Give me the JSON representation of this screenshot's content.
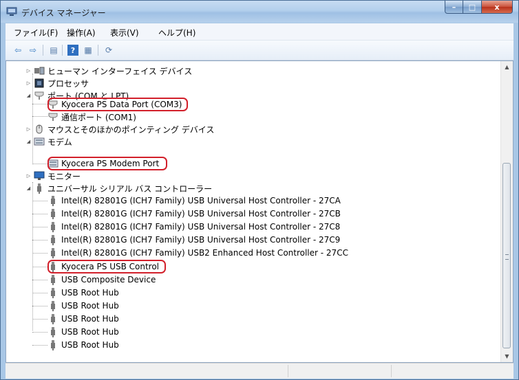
{
  "window": {
    "title": "デバイス マネージャー"
  },
  "caption": {
    "minimize": "–",
    "maximize": "□",
    "close": "x"
  },
  "menu": [
    "ファイル(F)",
    "操作(A)",
    "表示(V)",
    "ヘルプ(H)"
  ],
  "toolbar": {
    "buttons": [
      "back-arrow-icon",
      "forward-arrow-icon",
      "console-tree-icon",
      "help-icon",
      "properties-icon",
      "scan-hardware-icon"
    ],
    "glyphs": {
      "back": "⇦",
      "forward": "⇨",
      "tree": "▤",
      "help": "?",
      "props": "▦",
      "scan": "⟳"
    }
  },
  "tree": {
    "hid": "ヒューマン インターフェイス デバイス",
    "processor": "プロセッサ",
    "ports": "ポート (COM と LPT)",
    "ports_children": [
      "Kyocera PS Data Port (COM3)",
      "通信ポート (COM1)"
    ],
    "mouse": "マウスとそのほかのポインティング デバイス",
    "modem": "モデム",
    "modem_children": [
      "Kyocera PS Modem Port"
    ],
    "monitor": "モニター",
    "usb": "ユニバーサル シリアル バス コントローラー",
    "usb_children": [
      "Intel(R) 82801G (ICH7 Family) USB Universal Host Controller - 27CA",
      "Intel(R) 82801G (ICH7 Family) USB Universal Host Controller - 27CB",
      "Intel(R) 82801G (ICH7 Family) USB Universal Host Controller - 27C8",
      "Intel(R) 82801G (ICH7 Family) USB Universal Host Controller - 27C9",
      "Intel(R) 82801G (ICH7 Family) USB2 Enhanced Host Controller - 27CC",
      "Kyocera PS USB Control",
      "USB Composite Device",
      "USB Root Hub",
      "USB Root Hub",
      "USB Root Hub",
      "USB Root Hub",
      "USB Root Hub"
    ]
  },
  "colors": {
    "highlight": "#d21f2a",
    "accent": "#3a5a82"
  }
}
